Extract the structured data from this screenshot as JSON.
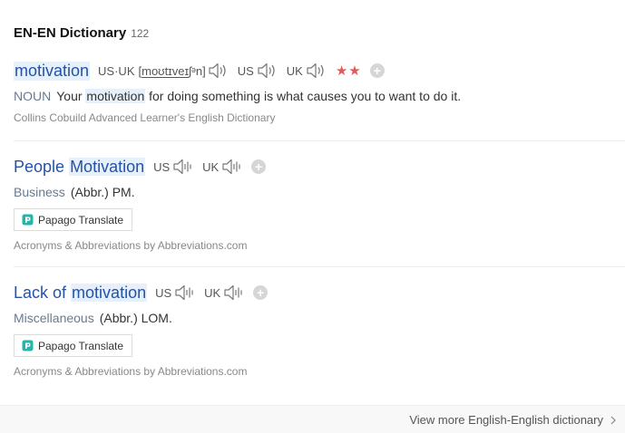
{
  "header": {
    "title": "EN-EN Dictionary",
    "count": "122"
  },
  "entries": [
    {
      "word": "motivation",
      "pronunciations": [
        {
          "label": "US·UK",
          "ipa_pre": "[",
          "ipa_u": "moʊtɪveɪ",
          "ipa_post": "ʃᵊn]"
        },
        {
          "label": "US"
        },
        {
          "label": "UK"
        }
      ],
      "stars": "★★",
      "pos": "NOUN",
      "definition": {
        "pre": "Your ",
        "highlight": "motivation",
        "post": " for doing something is what causes you to want to do it."
      },
      "source": "Collins Cobuild Advanced Learner's English Dictionary"
    },
    {
      "word_pre": "People ",
      "word_highlight": "Motivation",
      "pronunciations": [
        {
          "label": "US"
        },
        {
          "label": "UK"
        }
      ],
      "pos": "Business",
      "definition": "(Abbr.) PM.",
      "papago": "Papago Translate",
      "source": "Acronyms & Abbreviations by Abbreviations.com"
    },
    {
      "word_pre": "Lack of ",
      "word_highlight": "motivation",
      "pronunciations": [
        {
          "label": "US"
        },
        {
          "label": "UK"
        }
      ],
      "pos": "Miscellaneous",
      "definition": "(Abbr.) LOM.",
      "papago": "Papago Translate",
      "source": "Acronyms & Abbreviations by Abbreviations.com"
    }
  ],
  "footer": {
    "more_link": "View more English-English dictionary"
  }
}
